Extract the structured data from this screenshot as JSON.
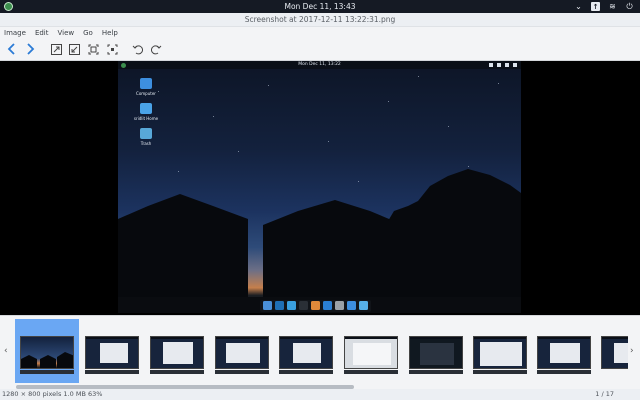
{
  "system_panel": {
    "clock": "Mon Dec 11, 13:43",
    "tray": [
      {
        "icon": "chevron-down-icon",
        "glyph": "⌄"
      },
      {
        "icon": "update-badge-icon",
        "glyph": "↑"
      },
      {
        "icon": "wifi-icon",
        "glyph": "≋"
      },
      {
        "icon": "power-icon",
        "glyph": "⏻"
      }
    ]
  },
  "window": {
    "title": "Screenshot at 2017-12-11 13:22:31.png"
  },
  "menu": {
    "items": [
      "Image",
      "Edit",
      "View",
      "Go",
      "Help"
    ]
  },
  "toolbar": {
    "buttons": [
      {
        "icon": "back-arrow-icon"
      },
      {
        "icon": "forward-arrow-icon"
      },
      {
        "icon": "zoom-in-icon"
      },
      {
        "icon": "zoom-out-icon"
      },
      {
        "icon": "fit-window-icon"
      },
      {
        "icon": "actual-size-icon"
      },
      {
        "icon": "rotate-left-icon"
      },
      {
        "icon": "rotate-right-icon"
      }
    ],
    "accent": "#2b7bd6"
  },
  "screenshot": {
    "clock": "Mon Dec 11, 13:22",
    "desktop_icons": [
      {
        "label": "Computer",
        "color": "#3d8fe0"
      },
      {
        "label": "sridlit Home",
        "color": "#4aa3e8"
      },
      {
        "label": "Trash",
        "color": "#58a8d8"
      }
    ],
    "dock_colors": [
      "#4a90d9",
      "#1f6fb5",
      "#3aa0e0",
      "#2a2f36",
      "#e0893a",
      "#2a7fd4",
      "#9aa1a8",
      "#3d8fe0",
      "#56b0e8"
    ]
  },
  "filmstrip": {
    "thumbnail_count": 10,
    "selected_index": 0,
    "selected_color": "#6aa7f3"
  },
  "status": {
    "info": "1280 × 800 pixels  1.0 MB   63%",
    "counter": "1 / 17"
  }
}
